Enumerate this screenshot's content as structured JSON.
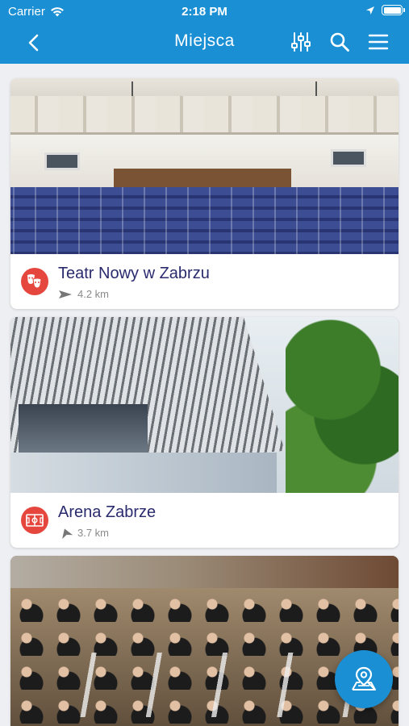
{
  "status_bar": {
    "carrier": "Carrier",
    "time": "2:18 PM"
  },
  "navbar": {
    "title": "Miejsca",
    "back_icon": "chevron-left-icon",
    "icons": [
      "filter-sliders-icon",
      "search-icon",
      "hamburger-menu-icon"
    ]
  },
  "places": [
    {
      "title": "Teatr Nowy w Zabrzu",
      "distance": "4.2 km",
      "category_icon": "theatre-masks-icon",
      "category_color": "#e5473e"
    },
    {
      "title": "Arena Zabrze",
      "distance": "3.7 km",
      "category_icon": "stadium-field-icon",
      "category_color": "#e5473e"
    },
    {
      "title": "",
      "distance": "",
      "category_icon": "",
      "category_color": "#e5473e"
    }
  ],
  "fab": {
    "icon": "map-pin-icon"
  },
  "colors": {
    "primary": "#1a8fd4",
    "title_text": "#2a2a6e",
    "background": "#eeeff2"
  }
}
